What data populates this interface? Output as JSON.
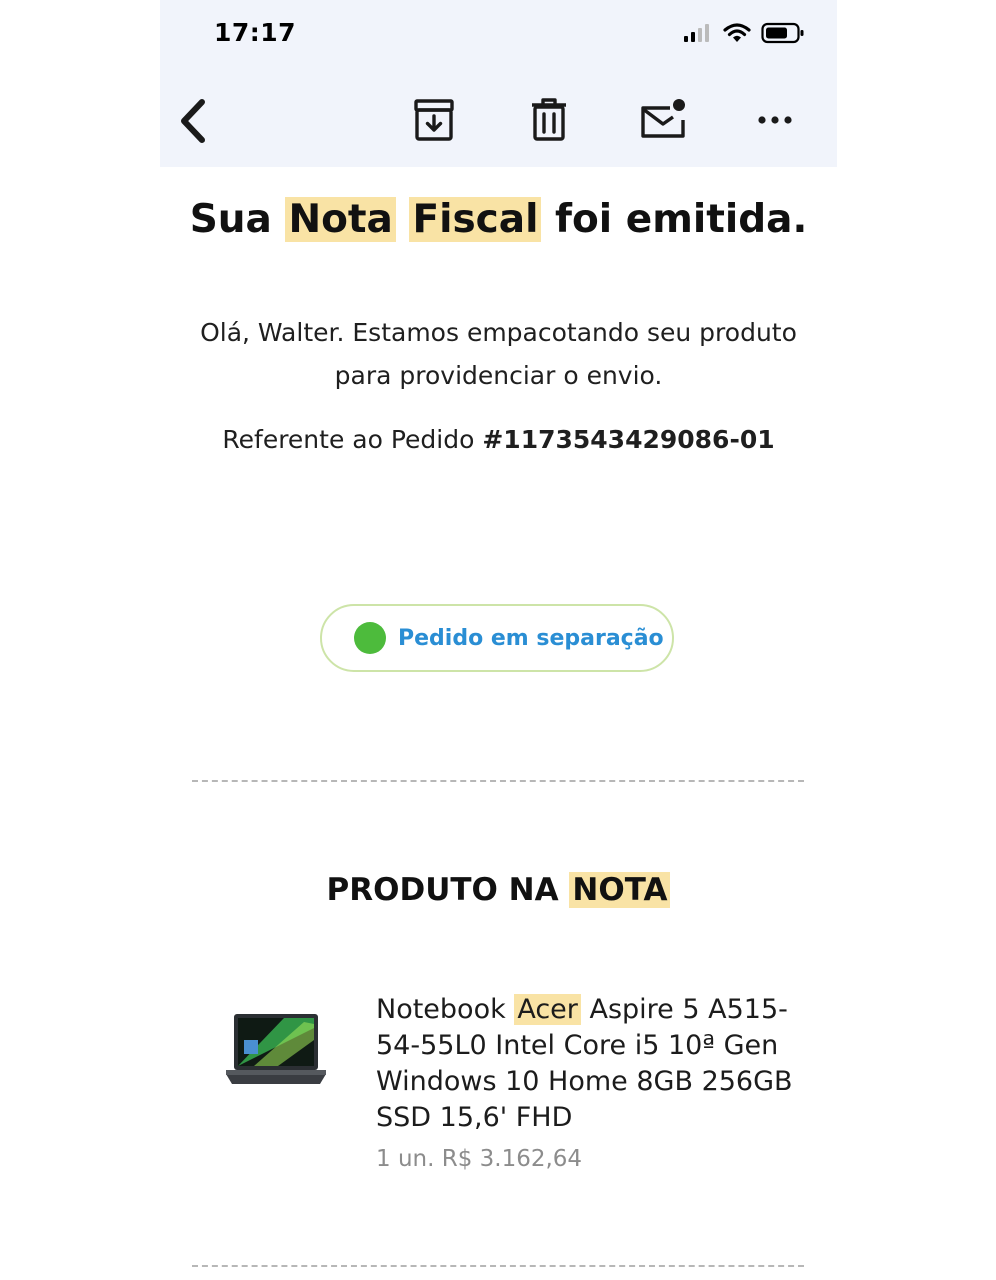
{
  "status_bar": {
    "time": "17:17"
  },
  "toolbar": {
    "back_icon": "chevron-left-icon",
    "archive_icon": "archive-icon",
    "delete_icon": "trash-icon",
    "mark_unread_icon": "mail-unread-icon",
    "more_icon": "more-horizontal-icon"
  },
  "email": {
    "title": {
      "part1": "Sua",
      "hl1": "Nota",
      "hl2": "Fiscal",
      "part2": "foi emitida."
    },
    "greeting_line1": "Olá, Walter. Estamos empacotando seu produto",
    "greeting_line2": "para providenciar o envio.",
    "order_prefix": "Referente ao Pedido",
    "order_number": "#1173543429086-01",
    "status_pill": {
      "label": "Pedido em separação",
      "dot_color": "#4dbb3c",
      "text_color": "#2a8ed4"
    },
    "section": {
      "part1": "PRODUTO NA",
      "hl": "NOTA"
    },
    "product": {
      "name_part1": "Notebook",
      "name_hl": "Acer",
      "name_part2": "Aspire 5 A515-",
      "name_line2": "54-55L0 Intel Core i5 10ª Gen",
      "name_line3": "Windows 10 Home 8GB 256GB",
      "name_line4": "SSD 15,6' FHD",
      "price": "1 un. R$ 3.162,64"
    }
  },
  "colors": {
    "highlight": "#f9e3a5",
    "topbar_bg": "#f1f4fb"
  }
}
